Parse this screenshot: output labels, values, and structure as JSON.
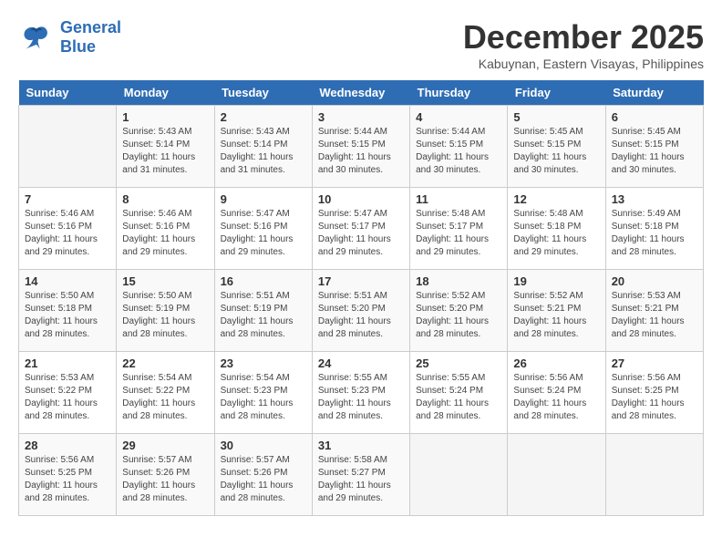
{
  "logo": {
    "line1": "General",
    "line2": "Blue"
  },
  "title": {
    "month_year": "December 2025",
    "location": "Kabuynan, Eastern Visayas, Philippines"
  },
  "weekdays": [
    "Sunday",
    "Monday",
    "Tuesday",
    "Wednesday",
    "Thursday",
    "Friday",
    "Saturday"
  ],
  "weeks": [
    [
      {
        "day": "",
        "empty": true
      },
      {
        "day": "1",
        "sunrise": "5:43 AM",
        "sunset": "5:14 PM",
        "daylight": "11 hours and 31 minutes."
      },
      {
        "day": "2",
        "sunrise": "5:43 AM",
        "sunset": "5:14 PM",
        "daylight": "11 hours and 31 minutes."
      },
      {
        "day": "3",
        "sunrise": "5:44 AM",
        "sunset": "5:15 PM",
        "daylight": "11 hours and 30 minutes."
      },
      {
        "day": "4",
        "sunrise": "5:44 AM",
        "sunset": "5:15 PM",
        "daylight": "11 hours and 30 minutes."
      },
      {
        "day": "5",
        "sunrise": "5:45 AM",
        "sunset": "5:15 PM",
        "daylight": "11 hours and 30 minutes."
      },
      {
        "day": "6",
        "sunrise": "5:45 AM",
        "sunset": "5:15 PM",
        "daylight": "11 hours and 30 minutes."
      }
    ],
    [
      {
        "day": "7",
        "sunrise": "5:46 AM",
        "sunset": "5:16 PM",
        "daylight": "11 hours and 29 minutes."
      },
      {
        "day": "8",
        "sunrise": "5:46 AM",
        "sunset": "5:16 PM",
        "daylight": "11 hours and 29 minutes."
      },
      {
        "day": "9",
        "sunrise": "5:47 AM",
        "sunset": "5:16 PM",
        "daylight": "11 hours and 29 minutes."
      },
      {
        "day": "10",
        "sunrise": "5:47 AM",
        "sunset": "5:17 PM",
        "daylight": "11 hours and 29 minutes."
      },
      {
        "day": "11",
        "sunrise": "5:48 AM",
        "sunset": "5:17 PM",
        "daylight": "11 hours and 29 minutes."
      },
      {
        "day": "12",
        "sunrise": "5:48 AM",
        "sunset": "5:18 PM",
        "daylight": "11 hours and 29 minutes."
      },
      {
        "day": "13",
        "sunrise": "5:49 AM",
        "sunset": "5:18 PM",
        "daylight": "11 hours and 28 minutes."
      }
    ],
    [
      {
        "day": "14",
        "sunrise": "5:50 AM",
        "sunset": "5:18 PM",
        "daylight": "11 hours and 28 minutes."
      },
      {
        "day": "15",
        "sunrise": "5:50 AM",
        "sunset": "5:19 PM",
        "daylight": "11 hours and 28 minutes."
      },
      {
        "day": "16",
        "sunrise": "5:51 AM",
        "sunset": "5:19 PM",
        "daylight": "11 hours and 28 minutes."
      },
      {
        "day": "17",
        "sunrise": "5:51 AM",
        "sunset": "5:20 PM",
        "daylight": "11 hours and 28 minutes."
      },
      {
        "day": "18",
        "sunrise": "5:52 AM",
        "sunset": "5:20 PM",
        "daylight": "11 hours and 28 minutes."
      },
      {
        "day": "19",
        "sunrise": "5:52 AM",
        "sunset": "5:21 PM",
        "daylight": "11 hours and 28 minutes."
      },
      {
        "day": "20",
        "sunrise": "5:53 AM",
        "sunset": "5:21 PM",
        "daylight": "11 hours and 28 minutes."
      }
    ],
    [
      {
        "day": "21",
        "sunrise": "5:53 AM",
        "sunset": "5:22 PM",
        "daylight": "11 hours and 28 minutes."
      },
      {
        "day": "22",
        "sunrise": "5:54 AM",
        "sunset": "5:22 PM",
        "daylight": "11 hours and 28 minutes."
      },
      {
        "day": "23",
        "sunrise": "5:54 AM",
        "sunset": "5:23 PM",
        "daylight": "11 hours and 28 minutes."
      },
      {
        "day": "24",
        "sunrise": "5:55 AM",
        "sunset": "5:23 PM",
        "daylight": "11 hours and 28 minutes."
      },
      {
        "day": "25",
        "sunrise": "5:55 AM",
        "sunset": "5:24 PM",
        "daylight": "11 hours and 28 minutes."
      },
      {
        "day": "26",
        "sunrise": "5:56 AM",
        "sunset": "5:24 PM",
        "daylight": "11 hours and 28 minutes."
      },
      {
        "day": "27",
        "sunrise": "5:56 AM",
        "sunset": "5:25 PM",
        "daylight": "11 hours and 28 minutes."
      }
    ],
    [
      {
        "day": "28",
        "sunrise": "5:56 AM",
        "sunset": "5:25 PM",
        "daylight": "11 hours and 28 minutes."
      },
      {
        "day": "29",
        "sunrise": "5:57 AM",
        "sunset": "5:26 PM",
        "daylight": "11 hours and 28 minutes."
      },
      {
        "day": "30",
        "sunrise": "5:57 AM",
        "sunset": "5:26 PM",
        "daylight": "11 hours and 28 minutes."
      },
      {
        "day": "31",
        "sunrise": "5:58 AM",
        "sunset": "5:27 PM",
        "daylight": "11 hours and 29 minutes."
      },
      {
        "day": "",
        "empty": true
      },
      {
        "day": "",
        "empty": true
      },
      {
        "day": "",
        "empty": true
      }
    ]
  ]
}
